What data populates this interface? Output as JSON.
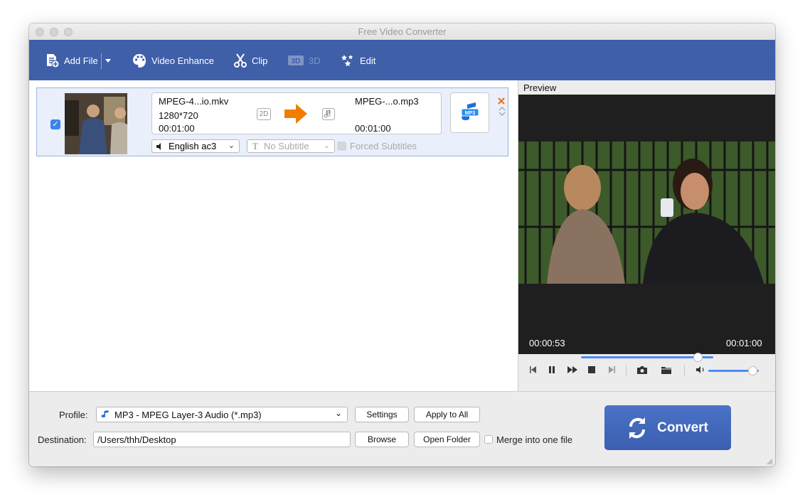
{
  "window": {
    "title": "Free Video Converter"
  },
  "toolbar": {
    "add_file": "Add File",
    "video_enhance": "Video Enhance",
    "clip": "Clip",
    "three_d": "3D",
    "edit": "Edit"
  },
  "file_item": {
    "checked": true,
    "source_name": "MPEG-4...io.mkv",
    "source_resolution": "1280*720",
    "source_duration": "00:01:00",
    "mode_badge": "2D",
    "target_name": "MPEG-...o.mp3",
    "target_duration": "00:01:00",
    "audio_track": "English ac3",
    "subtitle": "No Subtitle",
    "forced_subtitles": "Forced Subtitles",
    "output_format_badge": "MP3"
  },
  "preview": {
    "label": "Preview",
    "current_time": "00:00:53",
    "total_time": "00:01:00",
    "progress": 0.883,
    "volume": 0.88
  },
  "bottom": {
    "profile_label": "Profile:",
    "profile_value": "MP3 - MPEG Layer-3 Audio (*.mp3)",
    "settings": "Settings",
    "apply_to_all": "Apply to All",
    "destination_label": "Destination:",
    "destination_value": "/Users/thh/Desktop",
    "browse": "Browse",
    "open_folder": "Open Folder",
    "merge_label": "Merge into one file",
    "convert": "Convert"
  },
  "colors": {
    "toolbar_bg": "#3f5fa8",
    "accent_blue": "#4a8cf7",
    "convert_bg": "#3f64b8",
    "arrow_orange": "#f07d00",
    "delete_orange": "#e8701a"
  }
}
